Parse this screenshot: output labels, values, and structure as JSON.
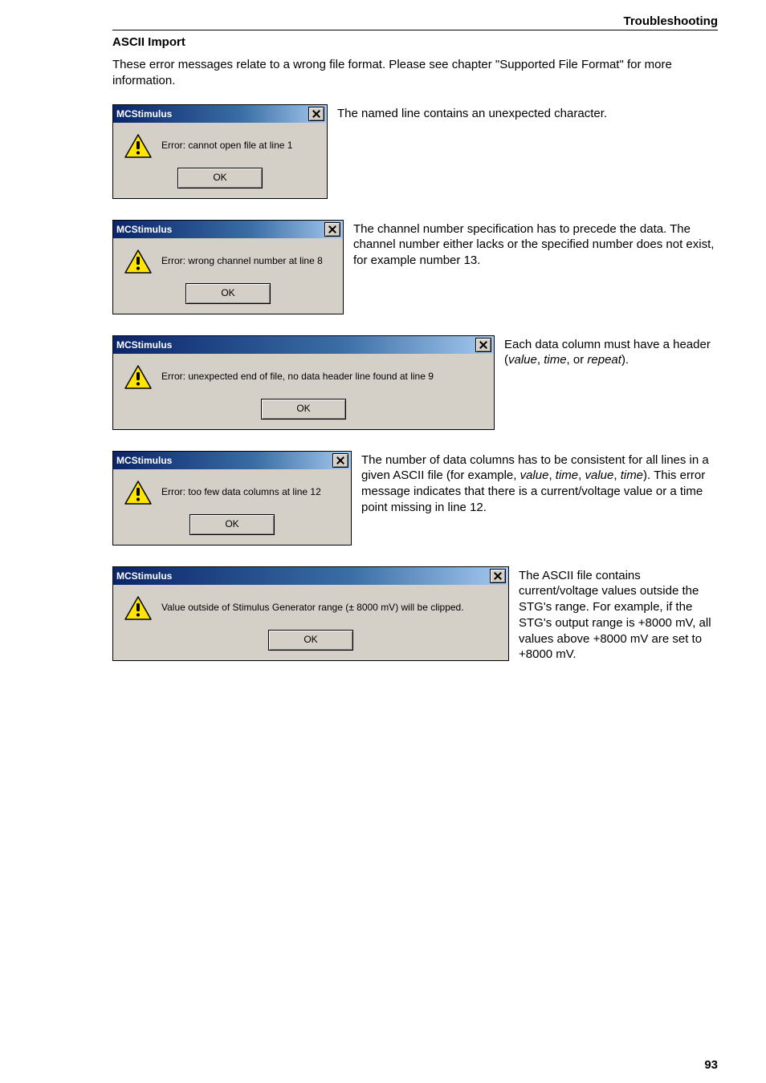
{
  "header": {
    "section": "Troubleshooting",
    "subheading": "ASCII Import"
  },
  "intro": "These error messages relate to a wrong file format. Please see chapter \"Supported File Format\" for more information.",
  "dialogs": {
    "title": "MCStimulus",
    "ok": "OK",
    "messages": {
      "m1": "Error: cannot open file at line 1",
      "m2": "Error: wrong channel number at line 8",
      "m3": "Error: unexpected end of file, no data header line found at line 9",
      "m4": "Error: too few data columns at line 12",
      "m5": "Value outside of Stimulus Generator range (± 8000 mV) will be clipped."
    }
  },
  "explanations": {
    "e1": "The named line contains an unexpected character.",
    "e2": "The channel number specification has to precede the data. The channel number either lacks or the specified number does not exist, for example number 13.",
    "e3_pre": "Each data column must have a header (",
    "e3_v": "value",
    "e3_sep1": ", ",
    "e3_t": "time",
    "e3_sep2": ", or ",
    "e3_r": "repeat",
    "e3_post": ").",
    "e4_pre": "The number of data columns has to be consistent for all lines in a given ASCII file (for example, ",
    "e4_v1": "value",
    "e4_s1": ", ",
    "e4_t1": "time",
    "e4_s2": ", ",
    "e4_v2": "value",
    "e4_s3": ", ",
    "e4_t2": "time",
    "e4_post": "). This error message indicates that there is a current/voltage value or a time point missing in line 12.",
    "e5": "The ASCII file contains current/voltage values outside the STG's range. For example, if the STG's output range is +8000 mV, all values above +8000 mV are set to +8000 mV."
  },
  "page_number": "93"
}
